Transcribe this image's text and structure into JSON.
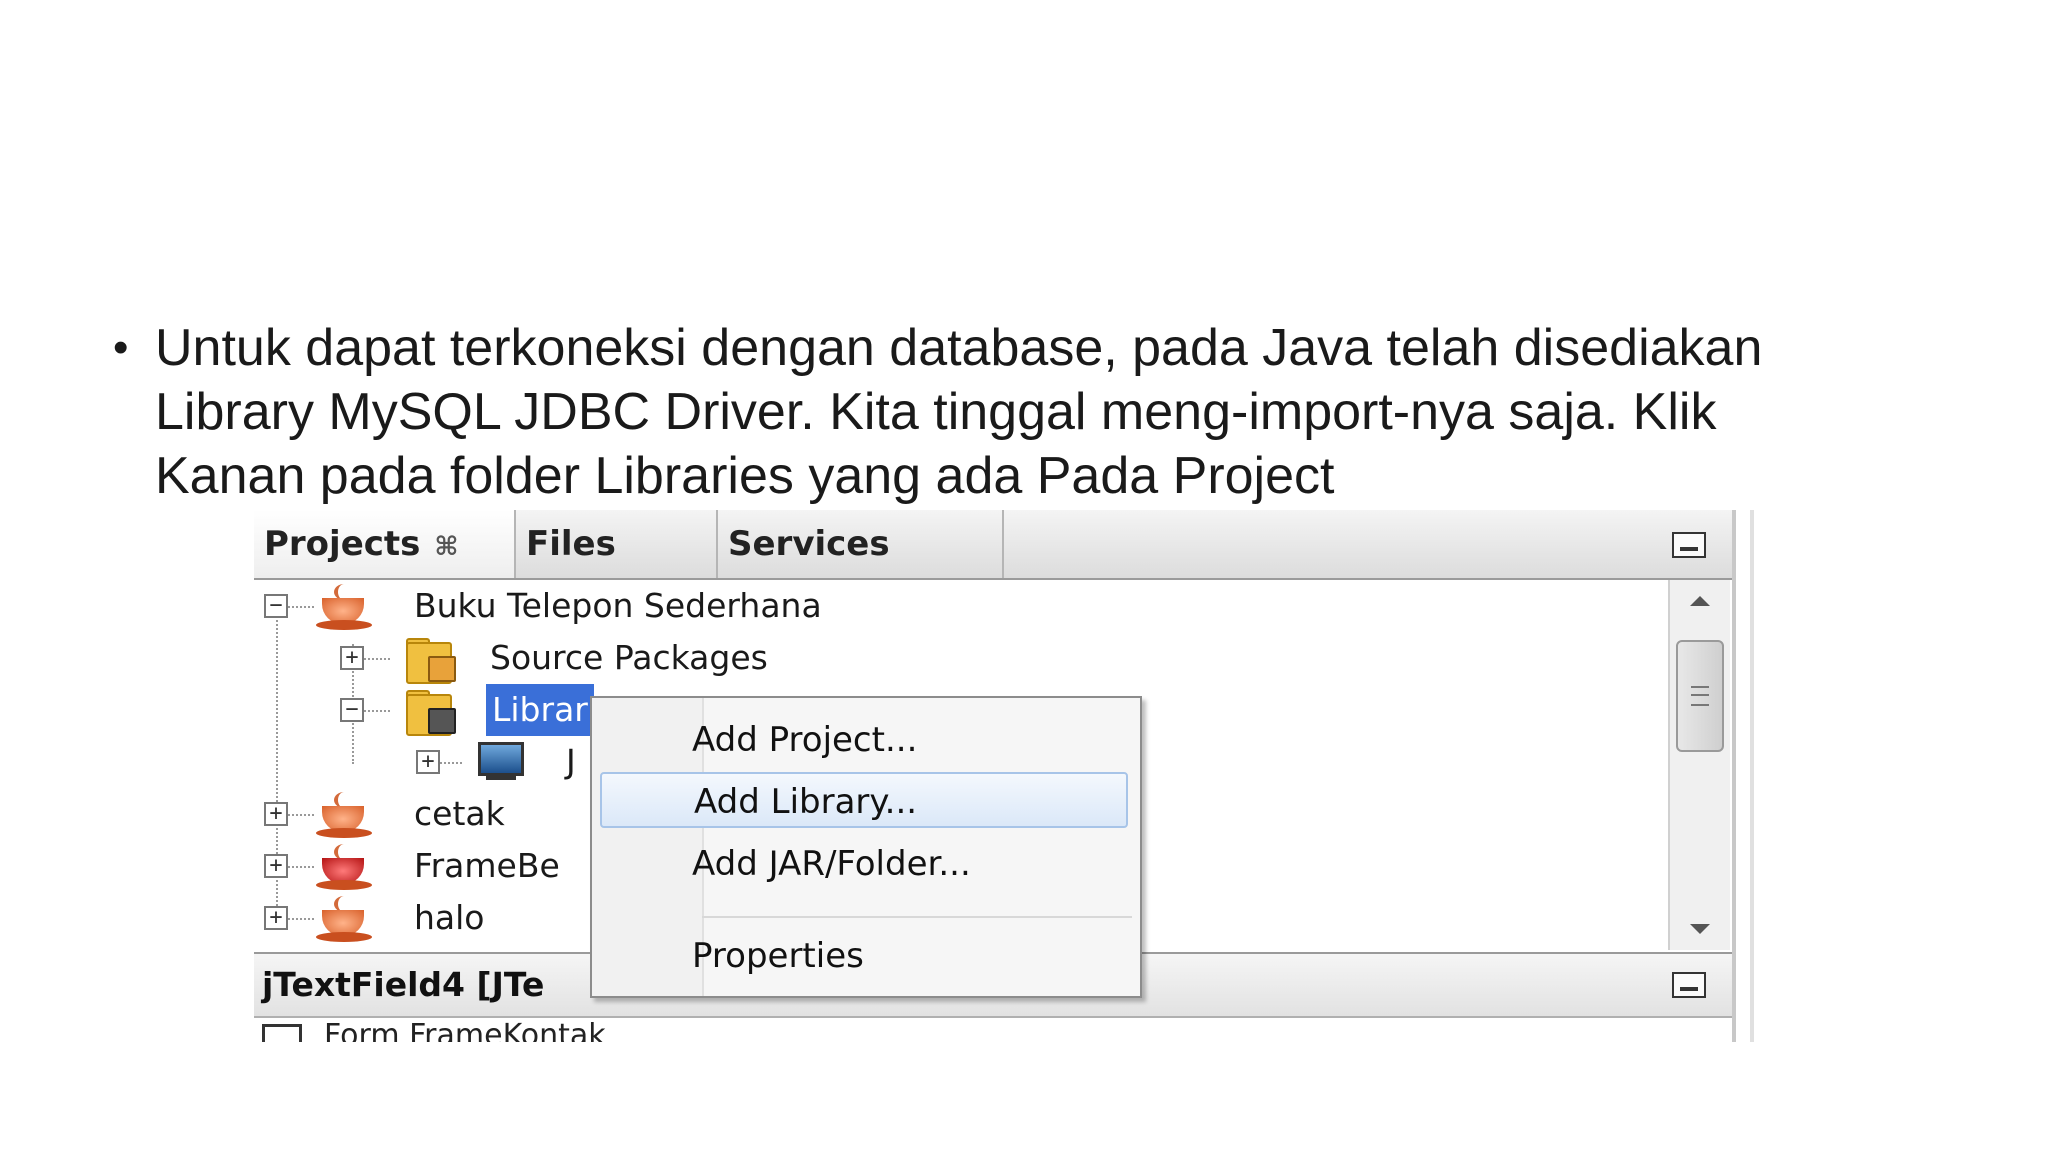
{
  "slide": {
    "bullet": "•",
    "lines": [
      "Untuk dapat terkoneksi dengan database, pada Java telah disediakan",
      "Library MySQL JDBC Driver. Kita tinggal meng-import-nya saja. Klik",
      "Kanan pada folder Libraries yang ada Pada Project"
    ]
  },
  "ide": {
    "tabs": [
      {
        "label": "Projects",
        "close": "⌘"
      },
      {
        "label": "Files"
      },
      {
        "label": "Services"
      }
    ],
    "tree": {
      "project": "Buku Telepon Sederhana",
      "source_packages": "Source Packages",
      "libraries_partial": "Librar",
      "jdk_partial": "J",
      "other_projects": [
        "cetak",
        "FrameBe",
        "halo"
      ]
    },
    "lower_panel": {
      "title": "jTextField4 [JTe",
      "form_row": "Form FrameKontak"
    },
    "context_menu": {
      "items": [
        "Add Project...",
        "Add Library...",
        "Add JAR/Folder...",
        "Properties"
      ],
      "hovered": "Add Library..."
    }
  }
}
